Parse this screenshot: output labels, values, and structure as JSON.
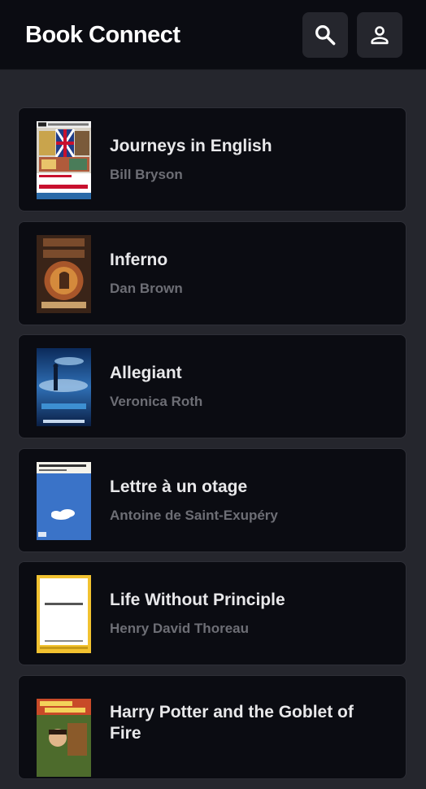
{
  "header": {
    "title": "Book Connect",
    "search_icon": "search-icon",
    "account_icon": "account-icon"
  },
  "colors": {
    "header_bg": "#0b0c12",
    "page_bg": "#25262d",
    "card_bg": "#0b0c12",
    "title_text": "#e8e8ea",
    "author_text": "#6d6e75"
  },
  "books": [
    {
      "title": "Journeys in English",
      "author": "Bill Bryson"
    },
    {
      "title": "Inferno",
      "author": "Dan Brown"
    },
    {
      "title": "Allegiant",
      "author": "Veronica Roth"
    },
    {
      "title": "Lettre à un otage",
      "author": "Antoine de Saint-Exupéry"
    },
    {
      "title": "Life Without Principle",
      "author": "Henry David Thoreau"
    },
    {
      "title": "Harry Potter and the Goblet of Fire",
      "author": ""
    }
  ]
}
